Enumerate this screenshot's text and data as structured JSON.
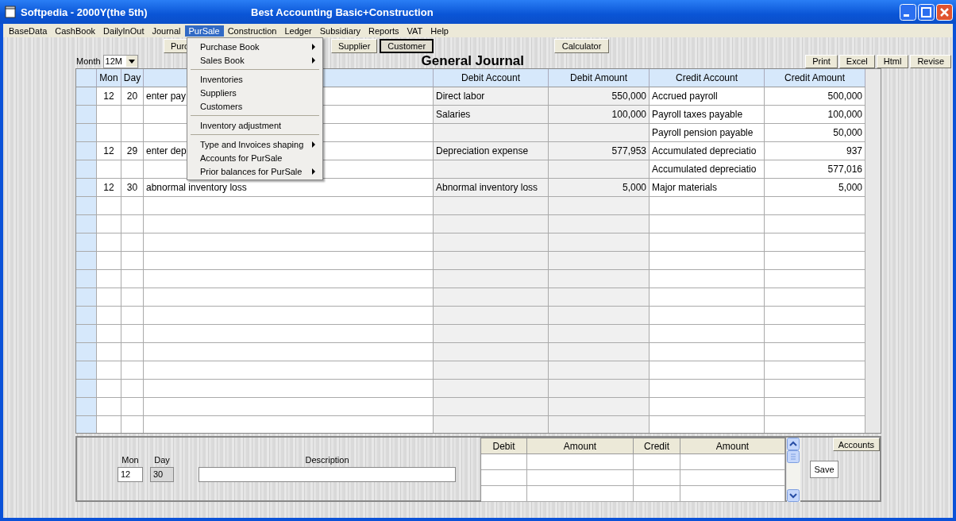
{
  "window": {
    "title": "Softpedia - 2000Y(the 5th)",
    "app_title": "Best Accounting Basic+Construction"
  },
  "menu_bar": [
    {
      "label": "BaseData",
      "selected": false
    },
    {
      "label": "CashBook",
      "selected": false
    },
    {
      "label": "DailyInOut",
      "selected": false
    },
    {
      "label": "Journal",
      "selected": false
    },
    {
      "label": "PurSale",
      "selected": true
    },
    {
      "label": "Construction",
      "selected": false
    },
    {
      "label": "Ledger",
      "selected": false
    },
    {
      "label": "Subsidiary",
      "selected": false
    },
    {
      "label": "Reports",
      "selected": false
    },
    {
      "label": "VAT",
      "selected": false
    },
    {
      "label": "Help",
      "selected": false
    }
  ],
  "open_menu": [
    {
      "kind": "item",
      "label": "Purchase Book",
      "submenu": true
    },
    {
      "kind": "item",
      "label": "Sales Book",
      "submenu": true
    },
    {
      "kind": "separator"
    },
    {
      "kind": "item",
      "label": "Inventories",
      "submenu": false
    },
    {
      "kind": "item",
      "label": "Suppliers",
      "submenu": false
    },
    {
      "kind": "item",
      "label": "Customers",
      "submenu": false
    },
    {
      "kind": "separator"
    },
    {
      "kind": "item",
      "label": "Inventory adjustment",
      "submenu": false
    },
    {
      "kind": "separator"
    },
    {
      "kind": "item",
      "label": "Type and Invoices shaping",
      "submenu": true
    },
    {
      "kind": "item",
      "label": "Accounts for PurSale",
      "submenu": false
    },
    {
      "kind": "item",
      "label": "Prior balances for PurSale",
      "submenu": true
    }
  ],
  "toolbar": [
    {
      "label": "Purc",
      "selected": false
    },
    {
      "label": "Supplier",
      "selected": false
    },
    {
      "label": "Customer",
      "selected": true
    }
  ],
  "calculator_button": "Calculator",
  "month": {
    "label": "Month",
    "value": "12M"
  },
  "title": "General Journal",
  "actions": [
    "Print",
    "Excel",
    "Html",
    "Revise"
  ],
  "table": {
    "columns": [
      "Mon",
      "Day",
      "Debit Account",
      "Debit Amount",
      "Credit Account",
      "Credit Amount"
    ],
    "rows": [
      {
        "mon": "12",
        "day": "20",
        "description": "enter pay",
        "debit_account": "Direct labor",
        "debit_amount": "550,000",
        "credit_account": "Accrued payroll",
        "credit_amount": "500,000"
      },
      {
        "debit_account": "Salaries",
        "debit_amount": "100,000",
        "credit_account": "Payroll taxes payable",
        "credit_amount": "100,000"
      },
      {
        "credit_account": "Payroll pension payable",
        "credit_amount": "50,000"
      },
      {
        "mon": "12",
        "day": "29",
        "description": "enter dep",
        "debit_account": "Depreciation expense",
        "debit_amount": "577,953",
        "credit_account": "Accumulated depreciatio",
        "credit_amount": "937"
      },
      {
        "credit_account": "Accumulated depreciatio",
        "credit_amount": "577,016"
      },
      {
        "mon": "12",
        "day": "30",
        "description": "abnormal inventory loss",
        "debit_account": "Abnormal inventory loss",
        "debit_amount": "5,000",
        "credit_account": "Major materials",
        "credit_amount": "5,000"
      }
    ]
  },
  "entry": {
    "mon_label": "Mon",
    "day_label": "Day",
    "description_label": "Description",
    "mon": "12",
    "day": "30",
    "day_disabled": true,
    "grid_columns": [
      "Debit",
      "Amount",
      "Credit",
      "Amount"
    ],
    "accounts_button": "Accounts",
    "save_button": "Save"
  }
}
